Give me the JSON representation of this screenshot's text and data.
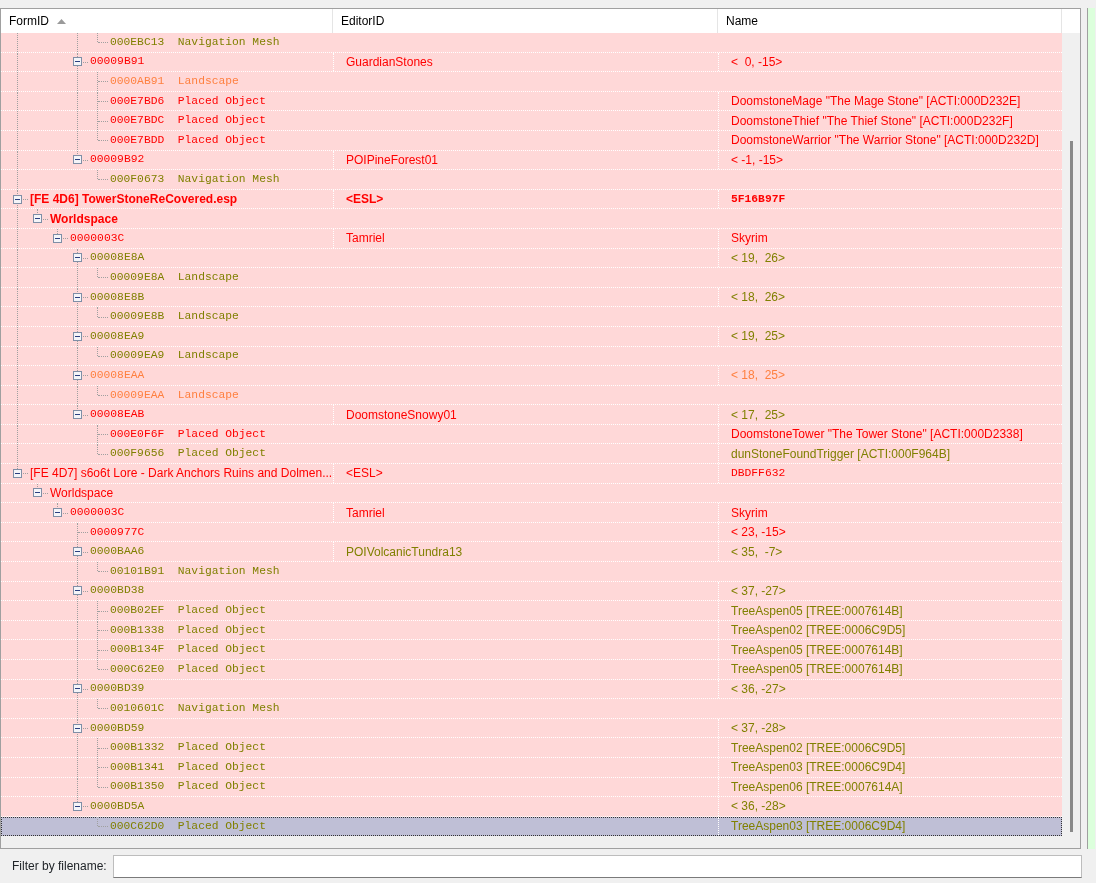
{
  "columns": [
    {
      "label": "FormID",
      "sort_ascending": true
    },
    {
      "label": "EditorID"
    },
    {
      "label": "Name"
    }
  ],
  "tree": [
    {
      "children": [
        {
          "children": [
            {
              "children": [
                {
                  "children": [
                    {
                      "kind": "record",
                      "text": "000EBC13  Navigation Mesh",
                      "color": "#808000",
                      "selected": false
                    }
                  ]
                },
                {
                  "kind": "record",
                  "text": "00009B91",
                  "editor_id": "GuardianStones",
                  "name": "<  0, -15>",
                  "color": "#ff0000",
                  "expanded": true,
                  "selected": false,
                  "children": [
                    {
                      "kind": "record",
                      "text": "0000AB91  Landscape",
                      "color": "#ff8040",
                      "selected": false
                    },
                    {
                      "kind": "record",
                      "text": "000E7BD6  Placed Object",
                      "name": "DoomstoneMage \"The Mage Stone\" [ACTI:000D232E]",
                      "color": "#ff0000",
                      "selected": false
                    },
                    {
                      "kind": "record",
                      "text": "000E7BDC  Placed Object",
                      "name": "DoomstoneThief \"The Thief Stone\" [ACTI:000D232F]",
                      "color": "#ff0000",
                      "selected": false
                    },
                    {
                      "kind": "record",
                      "text": "000E7BDD  Placed Object",
                      "name": "DoomstoneWarrior \"The Warrior Stone\" [ACTI:000D232D]",
                      "color": "#ff0000",
                      "selected": false
                    }
                  ]
                },
                {
                  "kind": "record",
                  "text": "00009B92",
                  "editor_id": "POIPineForest01",
                  "name": "< -1, -15>",
                  "color": "#ff0000",
                  "expanded": true,
                  "selected": false,
                  "children": [
                    {
                      "kind": "record",
                      "text": "000F0673  Navigation Mesh",
                      "color": "#808000",
                      "selected": false
                    }
                  ]
                }
              ]
            }
          ]
        }
      ]
    },
    {
      "kind": "plugin",
      "text": "[FE 4D6] TowerStoneReCovered.esp",
      "editor_id": "<ESL>",
      "name": "5F16B97F",
      "color": "#ff0000",
      "bold": true,
      "expanded": true,
      "selected": false,
      "children": [
        {
          "kind": "group",
          "text": "Worldspace",
          "color": "#ff0000",
          "bold": true,
          "expanded": true,
          "selected": false,
          "children": [
            {
              "kind": "record",
              "text": "0000003C",
              "editor_id": "Tamriel",
              "name": "Skyrim",
              "color": "#ff0000",
              "expanded": true,
              "selected": false,
              "children": [
                {
                  "kind": "record",
                  "text": "00008E8A",
                  "name": "< 19,  26>",
                  "color": "#808000",
                  "expanded": true,
                  "selected": false,
                  "children": [
                    {
                      "kind": "record",
                      "text": "00009E8A  Landscape",
                      "color": "#808000",
                      "selected": false
                    }
                  ]
                },
                {
                  "kind": "record",
                  "text": "00008E8B",
                  "name": "< 18,  26>",
                  "color": "#808000",
                  "expanded": true,
                  "selected": false,
                  "children": [
                    {
                      "kind": "record",
                      "text": "00009E8B  Landscape",
                      "color": "#808000",
                      "selected": false
                    }
                  ]
                },
                {
                  "kind": "record",
                  "text": "00008EA9",
                  "name": "< 19,  25>",
                  "color": "#808000",
                  "expanded": true,
                  "selected": false,
                  "children": [
                    {
                      "kind": "record",
                      "text": "00009EA9  Landscape",
                      "color": "#808000",
                      "selected": false
                    }
                  ]
                },
                {
                  "kind": "record",
                  "text": "00008EAA",
                  "name": "< 18,  25>",
                  "color": "#ff8040",
                  "expanded": true,
                  "selected": false,
                  "children": [
                    {
                      "kind": "record",
                      "text": "00009EAA  Landscape",
                      "color": "#ff8040",
                      "selected": false
                    }
                  ]
                },
                {
                  "kind": "record",
                  "text": "00008EAB",
                  "editor_id": "DoomstoneSnowy01",
                  "name": {
                    "text": "< 17,  25>",
                    "color": "#808000"
                  },
                  "color": "#ff0000",
                  "expanded": true,
                  "selected": false,
                  "children": [
                    {
                      "kind": "record",
                      "text": "000E0F6F  Placed Object",
                      "name": "DoomstoneTower \"The Tower Stone\" [ACTI:000D2338]",
                      "color": "#ff0000",
                      "selected": false
                    },
                    {
                      "kind": "record",
                      "text": "000F9656  Placed Object",
                      "name": "dunStoneFoundTrigger [ACTI:000F964B]",
                      "color": "#808000",
                      "selected": false
                    }
                  ]
                }
              ]
            }
          ]
        }
      ]
    },
    {
      "kind": "plugin",
      "text": "[FE 4D7] s6o6t Lore - Dark Anchors Ruins and Dolmen...",
      "editor_id": "<ESL>",
      "name": "DBDFF632",
      "color": "#ff0000",
      "bold": false,
      "expanded": true,
      "selected": false,
      "children": [
        {
          "kind": "group",
          "text": "Worldspace",
          "color": "#ff0000",
          "bold": false,
          "expanded": true,
          "selected": false,
          "children": [
            {
              "kind": "record",
              "text": "0000003C",
              "editor_id": "Tamriel",
              "name": "Skyrim",
              "color": "#ff0000",
              "expanded": true,
              "selected": false,
              "children": [
                {
                  "kind": "record",
                  "text": "0000977C",
                  "name": "< 23, -15>",
                  "color": "#ff0000",
                  "selected": false
                },
                {
                  "kind": "record",
                  "text": "0000BAA6",
                  "editor_id": "POIVolcanicTundra13",
                  "name": "< 35,  -7>",
                  "color": "#808000",
                  "expanded": true,
                  "selected": false,
                  "children": [
                    {
                      "kind": "record",
                      "text": "00101B91  Navigation Mesh",
                      "color": "#808000",
                      "selected": false
                    }
                  ]
                },
                {
                  "kind": "record",
                  "text": "0000BD38",
                  "name": "< 37, -27>",
                  "color": "#808000",
                  "expanded": true,
                  "selected": false,
                  "children": [
                    {
                      "kind": "record",
                      "text": "000B02EF  Placed Object",
                      "name": "TreeAspen05 [TREE:0007614B]",
                      "color": "#808000",
                      "selected": false
                    },
                    {
                      "kind": "record",
                      "text": "000B1338  Placed Object",
                      "name": "TreeAspen02 [TREE:0006C9D5]",
                      "color": "#808000",
                      "selected": false
                    },
                    {
                      "kind": "record",
                      "text": "000B134F  Placed Object",
                      "name": "TreeAspen05 [TREE:0007614B]",
                      "color": "#808000",
                      "selected": false
                    },
                    {
                      "kind": "record",
                      "text": "000C62E0  Placed Object",
                      "name": "TreeAspen05 [TREE:0007614B]",
                      "color": "#808000",
                      "selected": false
                    }
                  ]
                },
                {
                  "kind": "record",
                  "text": "0000BD39",
                  "name": "< 36, -27>",
                  "color": "#808000",
                  "expanded": true,
                  "selected": false,
                  "children": [
                    {
                      "kind": "record",
                      "text": "0010601C  Navigation Mesh",
                      "color": "#808000",
                      "selected": false
                    }
                  ]
                },
                {
                  "kind": "record",
                  "text": "0000BD59",
                  "name": "< 37, -28>",
                  "color": "#808000",
                  "expanded": true,
                  "selected": false,
                  "children": [
                    {
                      "kind": "record",
                      "text": "000B1332  Placed Object",
                      "name": "TreeAspen02 [TREE:0006C9D5]",
                      "color": "#808000",
                      "selected": false
                    },
                    {
                      "kind": "record",
                      "text": "000B1341  Placed Object",
                      "name": "TreeAspen03 [TREE:0006C9D4]",
                      "color": "#808000",
                      "selected": false
                    },
                    {
                      "kind": "record",
                      "text": "000B1350  Placed Object",
                      "name": "TreeAspen06 [TREE:0007614A]",
                      "color": "#808000",
                      "selected": false
                    }
                  ]
                },
                {
                  "kind": "record",
                  "text": "0000BD5A",
                  "name": "< 36, -28>",
                  "color": "#808000",
                  "expanded": true,
                  "selected": false,
                  "children": [
                    {
                      "kind": "record",
                      "text": "000C62D0  Placed Object",
                      "name": "TreeAspen03 [TREE:0006C9D4]",
                      "color": "#808000",
                      "selected": true
                    }
                  ]
                }
              ]
            }
          ]
        }
      ]
    }
  ],
  "filter": {
    "label": "Filter by filename:"
  }
}
